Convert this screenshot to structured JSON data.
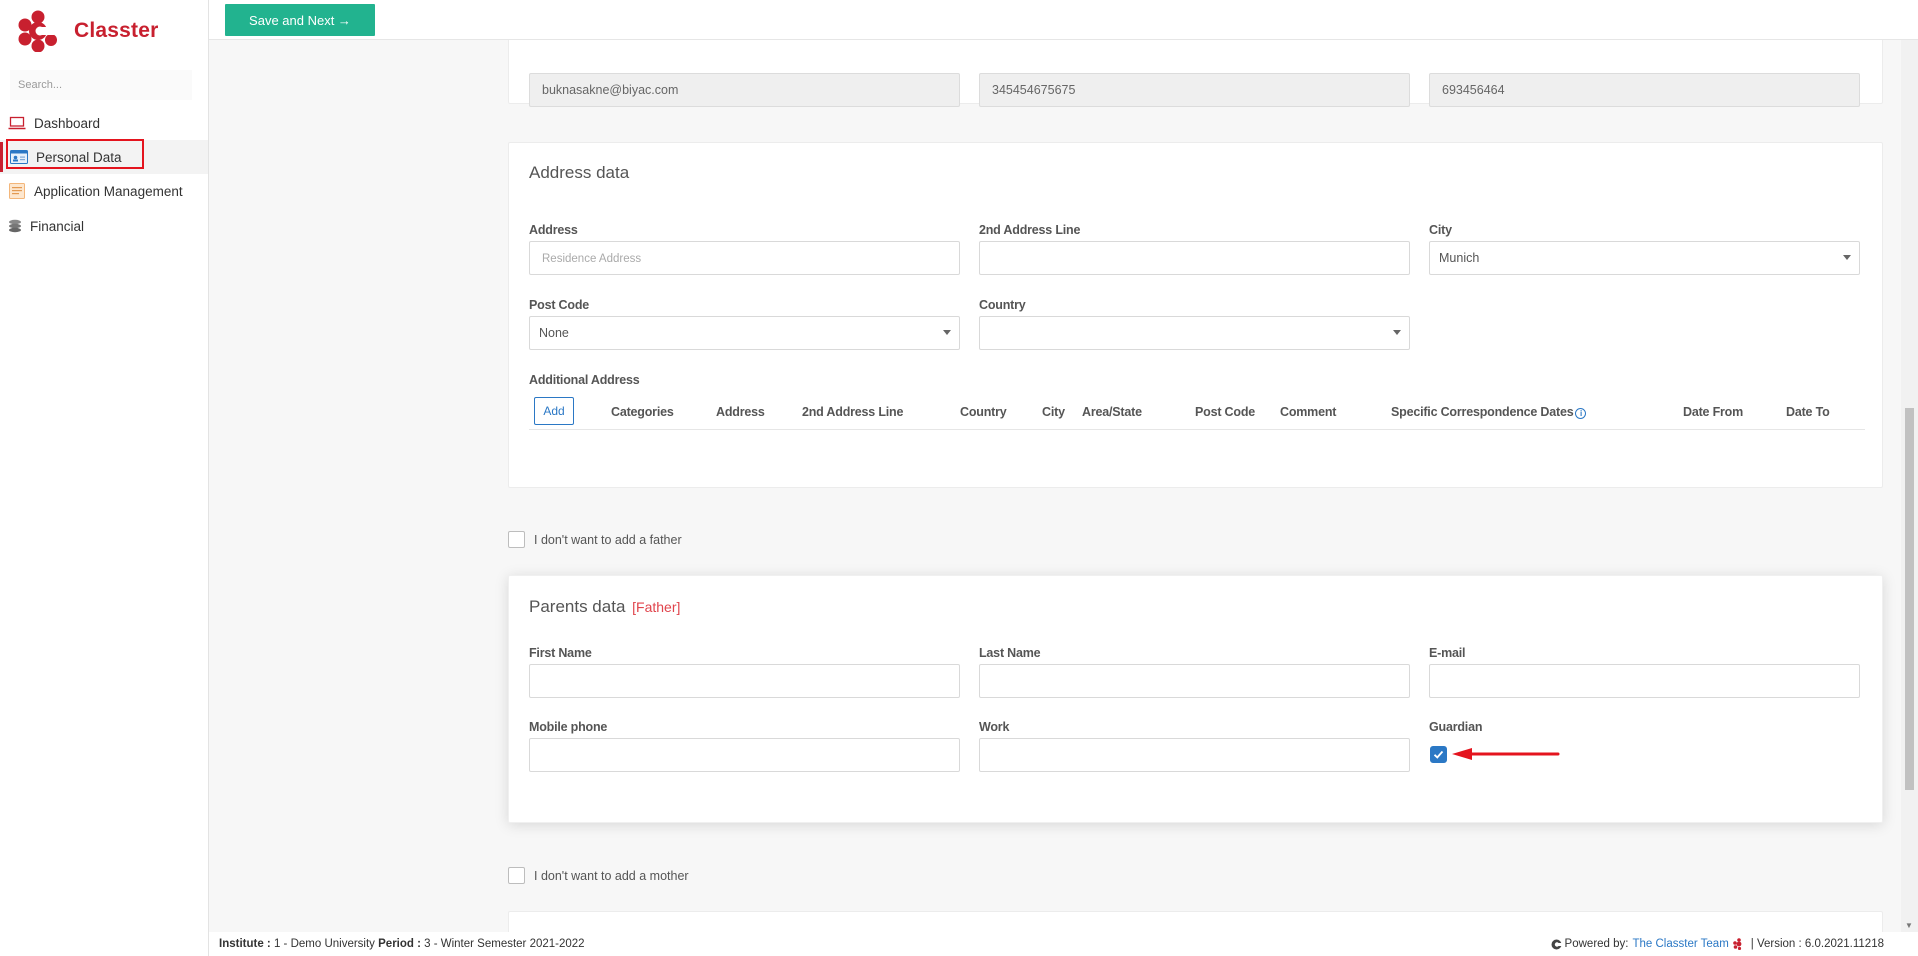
{
  "app": {
    "name": "Classter",
    "brand_color": "#c8202f"
  },
  "sidebar": {
    "search_placeholder": "Search...",
    "items": [
      {
        "label": "Dashboard",
        "icon": "laptop-icon"
      },
      {
        "label": "Personal Data",
        "icon": "id-card-icon",
        "active": true
      },
      {
        "label": "Application Management",
        "icon": "notepad-icon"
      },
      {
        "label": "Financial",
        "icon": "coins-icon"
      }
    ]
  },
  "toolbar": {
    "save_next_label": "Save and Next →"
  },
  "contact_row": {
    "email": "buknasakne@biyac.com",
    "phone": "345454675675",
    "mobile": "693456464"
  },
  "address": {
    "title": "Address data",
    "address_label": "Address",
    "address_placeholder": "Residence Address",
    "address2_label": "2nd Address Line",
    "city_label": "City",
    "city_value": "Munich",
    "postcode_label": "Post Code",
    "postcode_value": "None",
    "country_label": "Country",
    "country_value": "",
    "additional_label": "Additional Address",
    "add_button": "Add",
    "columns": [
      "Categories",
      "Address",
      "2nd Address Line",
      "Country",
      "City",
      "Area/State",
      "Post Code",
      "Comment",
      "Specific Correspondence Dates",
      "Date From",
      "Date To"
    ]
  },
  "father_opt_out": "I don't want to add a father",
  "parents": {
    "title": "Parents data",
    "tag": "[Father]",
    "first_name_label": "First Name",
    "last_name_label": "Last Name",
    "email_label": "E-mail",
    "mobile_label": "Mobile phone",
    "work_label": "Work",
    "guardian_label": "Guardian",
    "guardian_checked": true
  },
  "mother_opt_out": "I don't want to add a mother",
  "footer": {
    "institute_label": "Institute :",
    "institute_value": "1 - Demo University",
    "period_label": "Period :",
    "period_value": "3 - Winter Semester 2021-2022",
    "powered_label": "Powered by:",
    "powered_link": "The Classter Team",
    "version": "| Version : 6.0.2021.11218"
  },
  "colors": {
    "accent_green": "#22b38f",
    "link_blue": "#2b78c5",
    "annotation_red": "#e4141e"
  }
}
